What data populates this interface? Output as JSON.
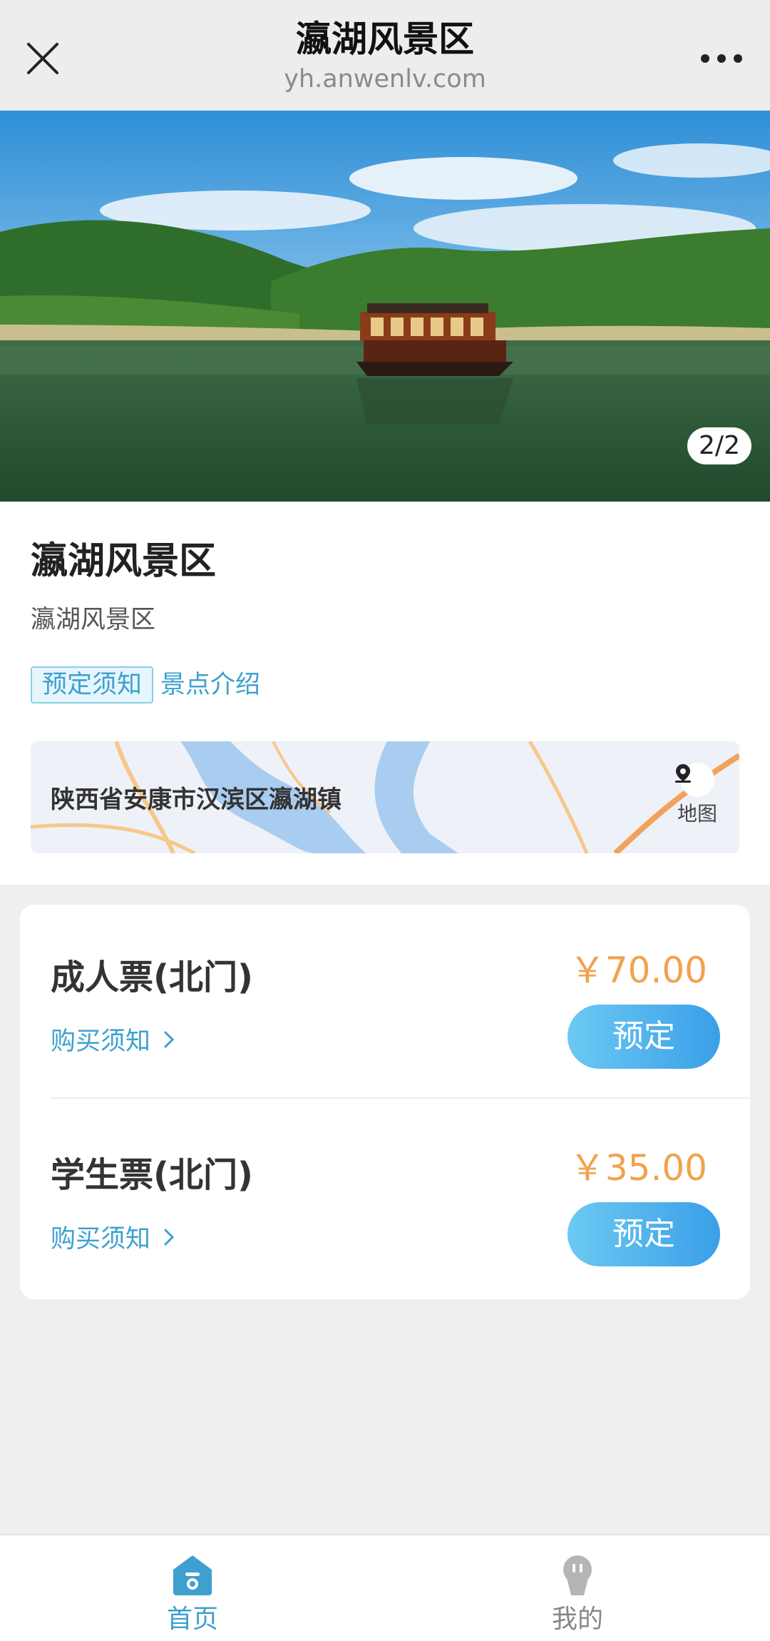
{
  "header": {
    "title": "瀛湖风景区",
    "url": "yh.anwenlv.com",
    "close_icon": "close-icon",
    "more_icon": "more-dots-icon"
  },
  "hero": {
    "counter": "2/2"
  },
  "info": {
    "title": "瀛湖风景区",
    "subtitle": "瀛湖风景区",
    "tabs": [
      {
        "label": "预定须知",
        "active": true
      },
      {
        "label": "景点介绍",
        "active": false
      }
    ],
    "address": "陕西省安康市汉滨区瀛湖镇",
    "map_label": "地图"
  },
  "tickets": [
    {
      "name": "成人票(北门)",
      "notice": "购买须知",
      "price": "￥70.00",
      "button": "预定"
    },
    {
      "name": "学生票(北门)",
      "notice": "购买须知",
      "price": "￥35.00",
      "button": "预定"
    }
  ],
  "bottom_nav": [
    {
      "label": "首页",
      "icon": "home-icon",
      "active": true
    },
    {
      "label": "我的",
      "icon": "profile-icon",
      "active": false
    }
  ],
  "colors": {
    "accent": "#3ea0cf",
    "price": "#f1a24e",
    "button_start": "#6cc9f2",
    "button_end": "#3a9fe8"
  }
}
